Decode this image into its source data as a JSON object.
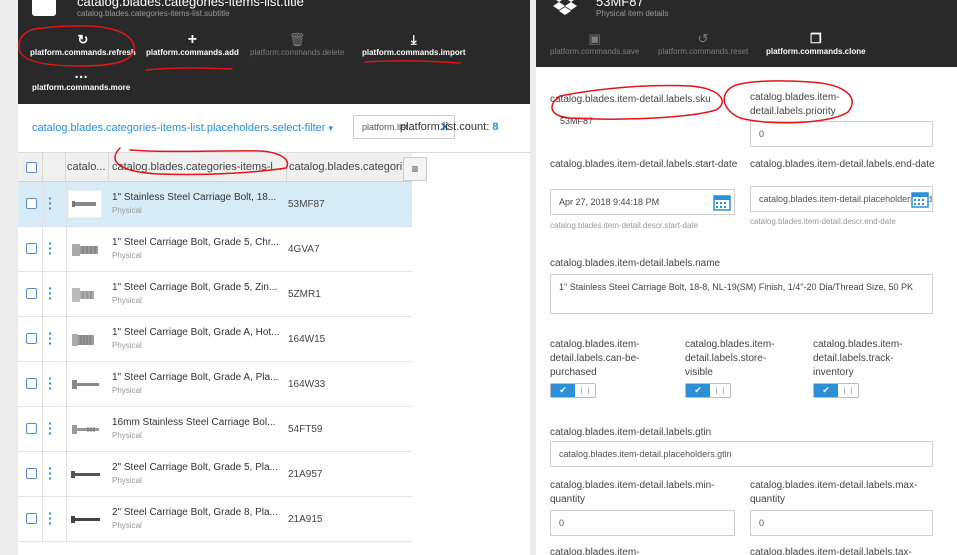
{
  "left_blade": {
    "title": "catalog.blades.categories-items-list.title",
    "subtitle": "catalog.blades.categories-items-list.subtitle",
    "toolbar": {
      "refresh": "platform.commands.refresh",
      "add": "platform.commands.add",
      "delete": "platform.commands.delete",
      "import": "platform.commands.import",
      "more": "platform.commands.more"
    },
    "filter_link": "catalog.blades.categories-items-list.placeholders.select-filter",
    "filter_select_value": "platform.list...",
    "list_count_label": "platform.list.count:",
    "list_count_value": "8",
    "columns": [
      "catalo...",
      "catalog.blades.categories-items-l...",
      "catalog.blades.categori..."
    ],
    "rows": [
      {
        "name": "1\" Stainless Steel Carriage Bolt, 18...",
        "type": "Physical",
        "code": "53MF87"
      },
      {
        "name": "1\" Steel Carriage Bolt, Grade 5, Chr...",
        "type": "Physical",
        "code": "4GVA7"
      },
      {
        "name": "1\" Steel Carriage Bolt, Grade 5, Zin...",
        "type": "Physical",
        "code": "5ZMR1"
      },
      {
        "name": "1\" Steel Carriage Bolt, Grade A, Hot...",
        "type": "Physical",
        "code": "164W15"
      },
      {
        "name": "1\" Steel Carriage Bolt, Grade A, Pla...",
        "type": "Physical",
        "code": "164W33"
      },
      {
        "name": "16mm Stainless Steel Carriage Bol...",
        "type": "Physical",
        "code": "54FT59"
      },
      {
        "name": "2\" Steel Carriage Bolt, Grade 5, Pla...",
        "type": "Physical",
        "code": "21A957"
      },
      {
        "name": "2\" Steel Carriage Bolt, Grade 8, Pla...",
        "type": "Physical",
        "code": "21A915"
      }
    ]
  },
  "right_blade": {
    "title": "53MF87",
    "subtitle": "Physical item details",
    "toolbar": {
      "save": "platform.commands.save",
      "reset": "platform.commands.reset",
      "clone": "platform.commands.clone"
    },
    "sku_label": "catalog.blades.item-detail.labels.sku",
    "sku_value": "53MF87",
    "priority_label": "catalog.blades.item-detail.labels.priority",
    "priority_value": "0",
    "start_date_label": "catalog.blades.item-detail.labels.start-date",
    "start_date_value": "Apr 27, 2018 9:44:18 PM",
    "start_date_descr": "catalog.blades.item-detail.descr.start-date",
    "end_date_label": "catalog.blades.item-detail.labels.end-date",
    "end_date_placeholder": "catalog.blades.item-detail.placeholders.end-date",
    "end_date_descr": "catalog.blades.item-detail.descr.end-date",
    "name_label": "catalog.blades.item-detail.labels.name",
    "name_value": "1\" Stainless Steel Carriage Bolt, 18-8, NL-19(SM) Finish, 1/4\"-20 Dia/Thread Size, 50 PK",
    "can_be_purchased_label": "catalog.blades.item-detail.labels.can-be-purchased",
    "store_visible_label": "catalog.blades.item-detail.labels.store-visible",
    "track_inventory_label": "catalog.blades.item-detail.labels.track-inventory",
    "gtin_label": "catalog.blades.item-detail.labels.gtin",
    "gtin_placeholder": "catalog.blades.item-detail.placeholders.gtin",
    "min_quantity_label": "catalog.blades.item-detail.labels.min-quantity",
    "min_quantity_value": "0",
    "max_quantity_label": "catalog.blades.item-detail.labels.max-quantity",
    "max_quantity_value": "0",
    "vendor_label_partial": "catalog.blades.item-",
    "tax_label_partial": "catalog.blades.item-detail.labels.tax-"
  },
  "colors": {
    "header_bg": "#292929",
    "accent": "#2d8fd6",
    "selected_row": "#d8ecf8",
    "annotation": "#e0161b"
  },
  "icons": {
    "refresh": "refresh-icon",
    "add": "plus-icon",
    "delete": "trash-icon",
    "import": "download-icon",
    "more": "ellipsis-icon",
    "save": "save-icon",
    "reset": "undo-icon",
    "clone": "clone-icon",
    "calendar": "calendar-icon"
  }
}
